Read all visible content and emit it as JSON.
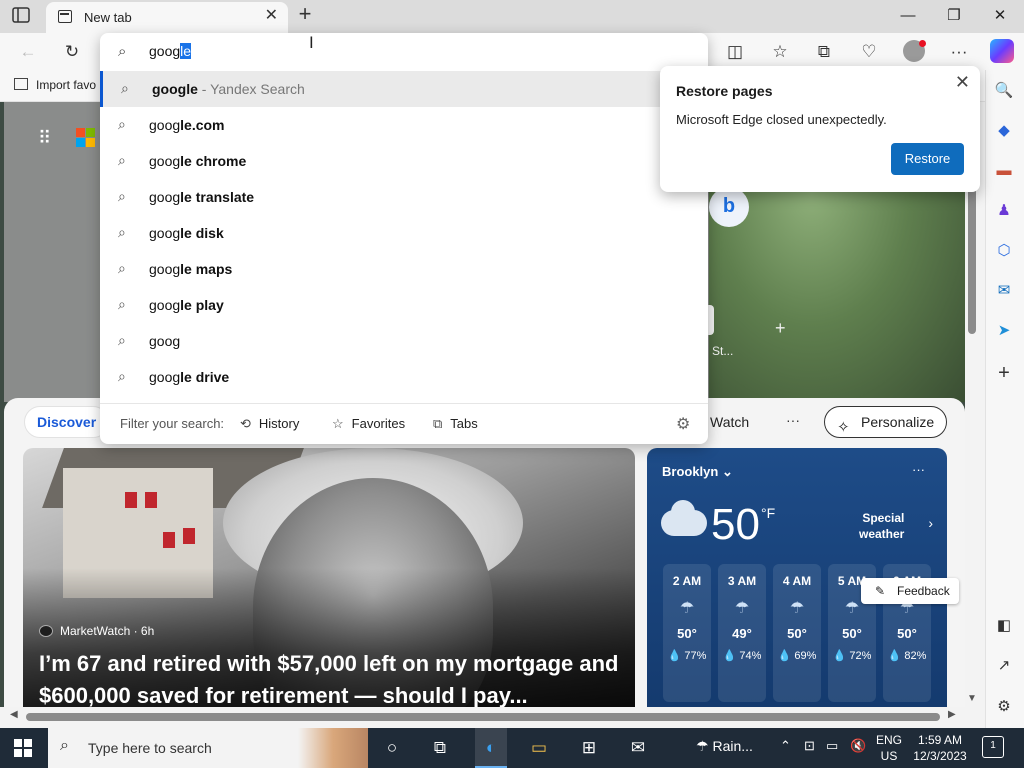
{
  "tab": {
    "title": "New tab",
    "close": "✕",
    "new": "+"
  },
  "window": {
    "minimize": "—",
    "maximize": "❐",
    "close": "✕"
  },
  "favorites_bar": {
    "import_label": "Import favo"
  },
  "omnibox": {
    "typed": "goog",
    "selected": "le",
    "suggestions": [
      {
        "bold_prefix": "google",
        "rest": "",
        "sub": " - Yandex Search"
      },
      {
        "prefix": "goog",
        "bold": "le.com"
      },
      {
        "prefix": "goog",
        "bold": "le chrome"
      },
      {
        "prefix": "goog",
        "bold": "le translate"
      },
      {
        "prefix": "goog",
        "bold": "le disk"
      },
      {
        "prefix": "goog",
        "bold": "le maps"
      },
      {
        "prefix": "goog",
        "bold": "le play"
      },
      {
        "prefix": "goog",
        "bold": ""
      },
      {
        "prefix": "goog",
        "bold": "le drive"
      }
    ],
    "filter_label": "Filter your search:",
    "filters": [
      "History",
      "Favorites",
      "Tabs"
    ]
  },
  "restore": {
    "title": "Restore pages",
    "message": "Microsoft Edge closed unexpectedly.",
    "button": "Restore"
  },
  "newtab": {
    "shortcut_label": "St...",
    "discover": "Discover",
    "watch": "Watch",
    "more": "···",
    "personalize": "Personalize",
    "hero": {
      "source": "MarketWatch · 6h",
      "headline": "I’m 67 and retired with $57,000 left on my mortgage and $600,000 saved for retirement — should I pay..."
    },
    "weather": {
      "city": "Brooklyn",
      "temp": "50",
      "unit": "°F",
      "alert_line1": "Special",
      "alert_line2": "weather",
      "hours": [
        {
          "time": "2 AM",
          "temp": "50°",
          "precip": "💧 77%"
        },
        {
          "time": "3 AM",
          "temp": "49°",
          "precip": "💧 74%"
        },
        {
          "time": "4 AM",
          "temp": "50°",
          "precip": "💧 69%"
        },
        {
          "time": "5 AM",
          "temp": "50°",
          "precip": "💧 72%"
        },
        {
          "time": "6 AM",
          "temp": "50°",
          "precip": "💧 82%"
        }
      ]
    },
    "feedback": "Feedback"
  },
  "taskbar": {
    "search_placeholder": "Type here to search",
    "weather": "Rain...",
    "lang_line1": "ENG",
    "lang_line2": "US",
    "time": "1:59 AM",
    "date": "12/3/2023",
    "notifications": "1"
  },
  "colors": {
    "accent": "#0f6cbd",
    "selection": "#1a73e8",
    "taskbar": "#1f2b38",
    "weather_card": "#1e4c88"
  }
}
